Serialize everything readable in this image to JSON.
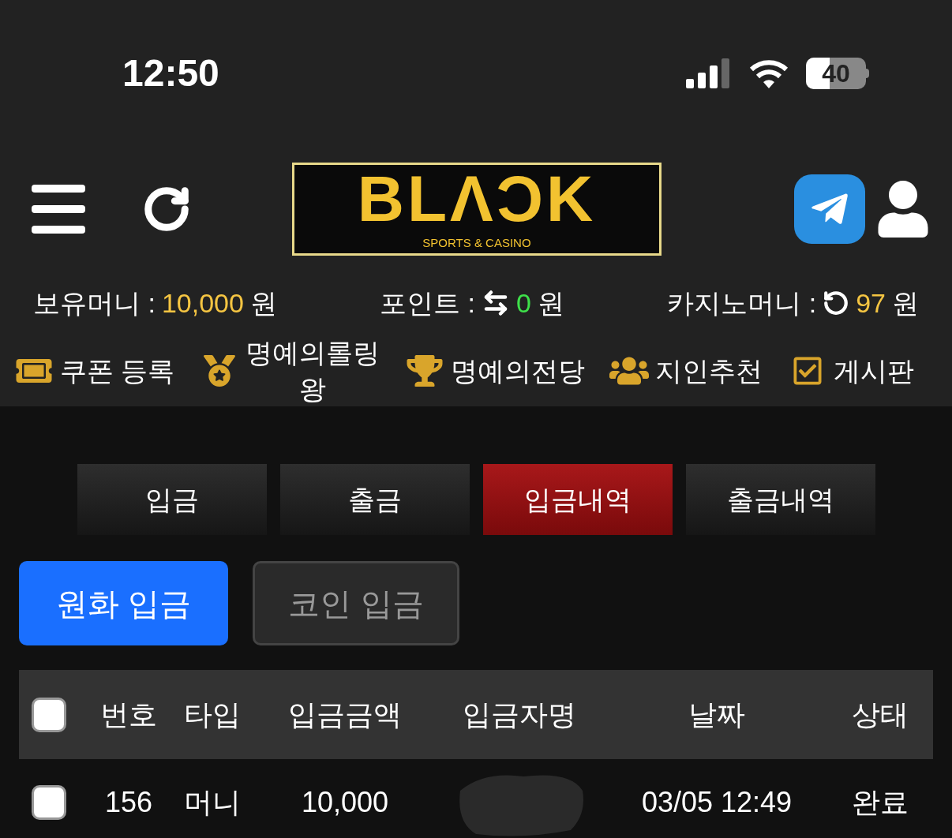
{
  "status_bar": {
    "time": "12:50",
    "battery": "40"
  },
  "header": {
    "logo": {
      "wordmark": "BLΛϽK",
      "tagline": "SPORTS & CASINO"
    }
  },
  "balances": [
    {
      "label": "보유머니 :",
      "kind": "plain",
      "amount": "10,000",
      "unit": "원",
      "color": "#f5c542"
    },
    {
      "label": "포인트 :",
      "kind": "transfer",
      "amount": "0",
      "unit": "원",
      "color": "#3ee04a"
    },
    {
      "label": "카지노머니 :",
      "kind": "refresh",
      "amount": "97",
      "unit": "원",
      "color": "#f5c542"
    }
  ],
  "menu": [
    {
      "label": "쿠폰 등록",
      "kind": "coupon"
    },
    {
      "label": "명예의롤링왕",
      "kind": "medal"
    },
    {
      "label": "명예의전당",
      "kind": "trophy"
    },
    {
      "label": "지인추천",
      "kind": "people"
    },
    {
      "label": "게시판",
      "kind": "board"
    }
  ],
  "tabs": [
    {
      "label": "입금",
      "selected": false
    },
    {
      "label": "출금",
      "selected": false
    },
    {
      "label": "입금내역",
      "selected": true
    },
    {
      "label": "출금내역",
      "selected": false
    }
  ],
  "deposit_types": [
    {
      "label": "원화 입금",
      "selected": true
    },
    {
      "label": "코인 입금",
      "selected": false
    }
  ],
  "table": {
    "select_all": {
      "checked": false
    },
    "columns": [
      "번호",
      "타입",
      "입금금액",
      "입금자명",
      "날짜",
      "상태"
    ],
    "rows": [
      {
        "checked": false,
        "number": "156",
        "type": "머니",
        "amount": "10,000",
        "date": "03/05 12:49",
        "status": "완료"
      }
    ]
  }
}
